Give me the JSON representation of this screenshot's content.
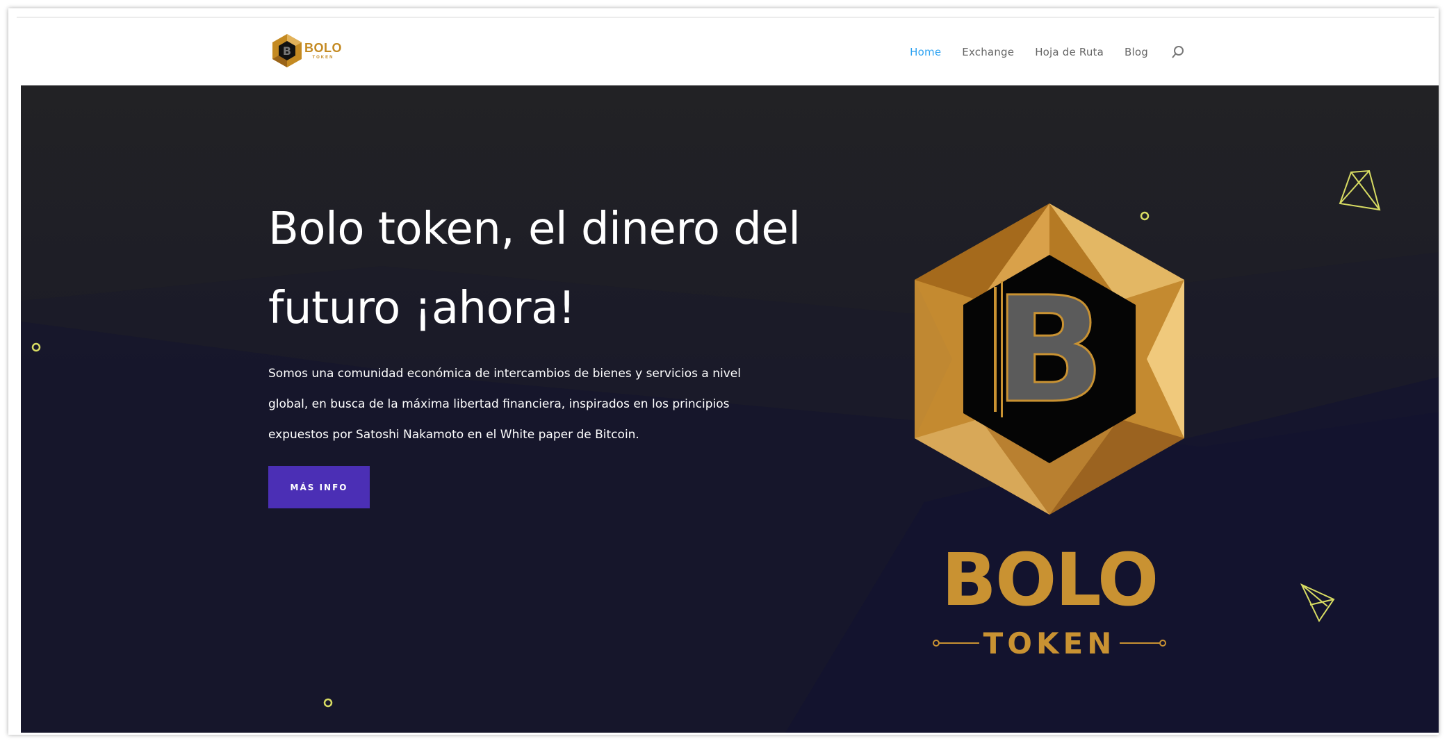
{
  "header": {
    "logo": {
      "word": "BOLO",
      "sub": "TOKEN",
      "mark_letter": "B"
    },
    "nav": [
      {
        "label": "Home",
        "active": true
      },
      {
        "label": "Exchange",
        "active": false
      },
      {
        "label": "Hoja de Ruta",
        "active": false
      },
      {
        "label": "Blog",
        "active": false
      }
    ],
    "search_icon": "search-icon"
  },
  "hero": {
    "headline_line1": "Bolo token, el dinero del",
    "headline_line2": "futuro ¡ahora!",
    "description_line1": "Somos una comunidad económica de intercambios de bienes y servicios a nivel",
    "description_line2": "global, en busca de la máxima libertad financiera, inspirados en los principios",
    "description_line3": "expuestos por Satoshi Nakamoto en el White paper de Bitcoin.",
    "cta_label": "MÁS INFO",
    "brand_word": "BOLO",
    "brand_sub": "TOKEN",
    "emblem_letter": "B"
  },
  "colors": {
    "accent_gold": "#c99232",
    "cta_purple": "#4b2fb5",
    "nav_active": "#2ea3f2",
    "hero_dark": "#16162e",
    "deco_yellow": "#d8dc63"
  }
}
